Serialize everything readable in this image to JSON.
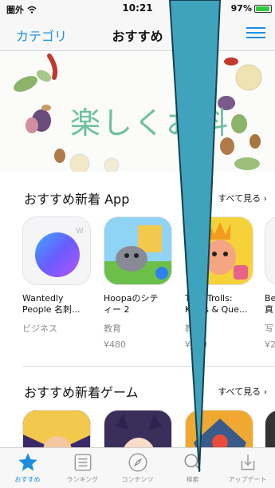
{
  "status": {
    "carrier": "圏外",
    "time": "10:21",
    "battery": "97%",
    "battery_level": 0.97
  },
  "nav": {
    "left": "カテゴリ",
    "title": "おすすめ"
  },
  "banner": {
    "text": "楽しくお料"
  },
  "sections": [
    {
      "title": "おすすめ新着 App",
      "see_all": "すべて見る",
      "apps": [
        {
          "name": "Wantedly\nPeople 名刺...",
          "category": "ビジネス",
          "price": ""
        },
        {
          "name": "Hoopaのシテ\nィー 2",
          "category": "教育",
          "price": "¥480"
        },
        {
          "name": "Toca Trolls:\nKings & Que...",
          "category": "教育",
          "price": "¥360"
        },
        {
          "name": "Be\n真",
          "category": "写",
          "price": "¥2"
        }
      ]
    },
    {
      "title": "おすすめ新着ゲーム",
      "see_all": "すべて見る"
    }
  ],
  "tabs": [
    {
      "label": "おすすめ",
      "icon": "star-icon",
      "active": true
    },
    {
      "label": "ランキング",
      "icon": "list-icon",
      "active": false
    },
    {
      "label": "コンテンツ",
      "icon": "compass-icon",
      "active": false
    },
    {
      "label": "検索",
      "icon": "search-icon",
      "active": false
    },
    {
      "label": "アップデート",
      "icon": "download-tray-icon",
      "active": false
    }
  ],
  "colors": {
    "accent": "#1a8fe0",
    "pointer": "#3fa3bd",
    "banner_text": "#6cc0a0"
  }
}
